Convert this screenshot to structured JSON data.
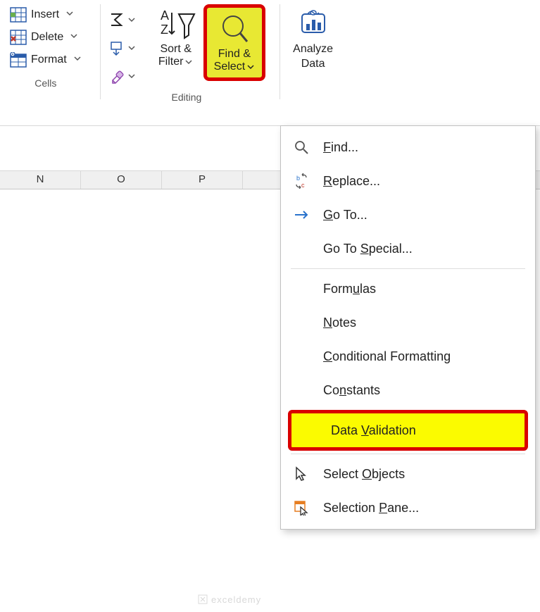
{
  "ribbon": {
    "cells": {
      "insert": "Insert",
      "delete": "Delete",
      "format": "Format",
      "group_label": "Cells"
    },
    "editing": {
      "sort_line1": "Sort &",
      "sort_line2": "Filter",
      "find_line1": "Find &",
      "find_line2": "Select",
      "group_label": "Editing"
    },
    "analysis": {
      "analyze_line1": "Analyze",
      "analyze_line2": "Data"
    }
  },
  "columns": [
    "N",
    "O",
    "P"
  ],
  "menu": {
    "find": "Find...",
    "replace": "Replace...",
    "goto": "Go To...",
    "goto_special": "Go To Special...",
    "formulas": "Formulas",
    "notes": "Notes",
    "cond_format": "Conditional Formatting",
    "constants": "Constants",
    "data_validation": "Data Validation",
    "select_objects": "Select Objects",
    "selection_pane": "Selection Pane..."
  },
  "watermark": "exceldemy"
}
